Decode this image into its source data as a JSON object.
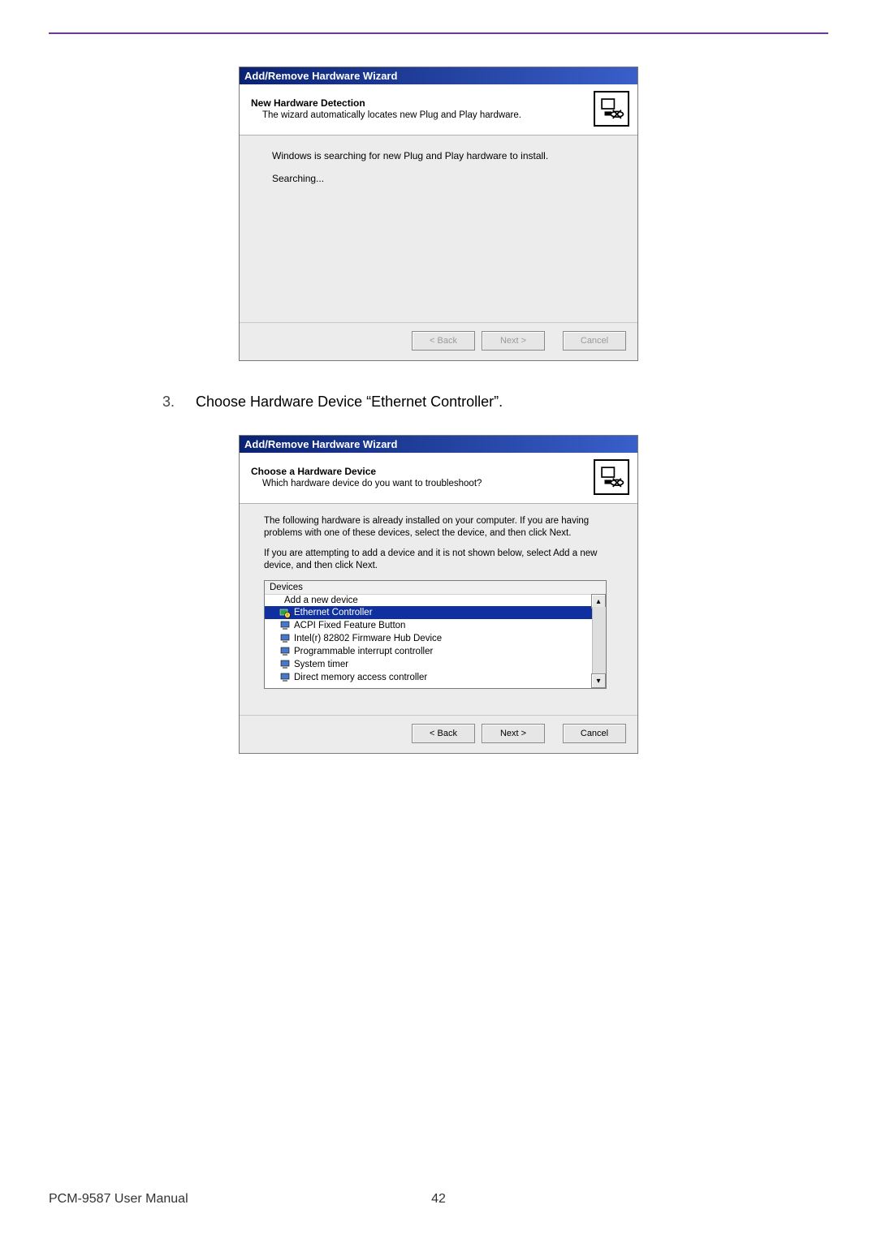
{
  "page": {
    "manual_name": "PCM-9587 User Manual",
    "page_number": "42"
  },
  "step": {
    "number": "3.",
    "text": "Choose Hardware Device “Ethernet Controller”."
  },
  "dialog1": {
    "title": "Add/Remove Hardware Wizard",
    "header_title": "New Hardware Detection",
    "header_sub": "The wizard automatically locates new Plug and Play hardware.",
    "body_line1": "Windows is searching for new Plug and Play hardware to install.",
    "body_line2": "Searching...",
    "buttons": {
      "back": "< Back",
      "next": "Next >",
      "cancel": "Cancel"
    }
  },
  "dialog2": {
    "title": "Add/Remove Hardware Wizard",
    "header_title": "Choose a Hardware Device",
    "header_sub": "Which hardware device do you want to troubleshoot?",
    "intro1": "The following hardware is already installed on your computer. If you are having problems with one of these devices, select the device, and then click Next.",
    "intro2": "If you are attempting to add a device and it is not shown below, select Add a new device, and then click Next.",
    "list_header": "Devices",
    "items": {
      "add_new": "Add a new device",
      "ethernet": "Ethernet Controller",
      "acpi": "ACPI Fixed Feature Button",
      "intel": "Intel(r) 82802 Firmware Hub Device",
      "pic": "Programmable interrupt controller",
      "timer": "System timer",
      "dma": "Direct memory access controller"
    },
    "buttons": {
      "back": "< Back",
      "next": "Next >",
      "cancel": "Cancel"
    }
  }
}
